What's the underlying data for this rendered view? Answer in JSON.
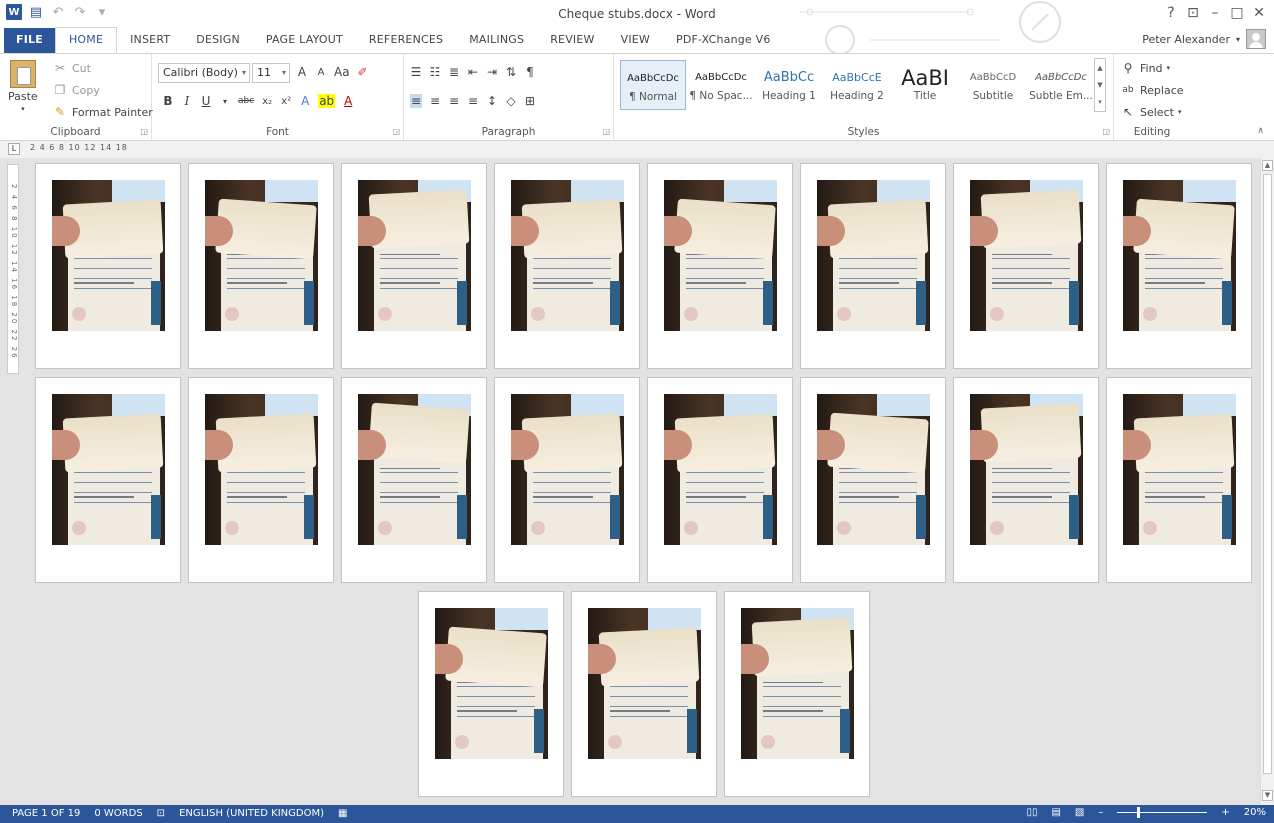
{
  "window": {
    "title": "Cheque stubs.docx - Word",
    "user_name": "Peter Alexander",
    "app_icon": "W"
  },
  "qat": {
    "save_icon": "save-icon",
    "undo_icon": "undo-icon",
    "redo_icon": "redo-icon",
    "customize_icon": "customize-qat-icon"
  },
  "window_controls": [
    "?",
    "⊡",
    "–",
    "□",
    "✕"
  ],
  "tabs": [
    {
      "label": "FILE"
    },
    {
      "label": "HOME"
    },
    {
      "label": "INSERT"
    },
    {
      "label": "DESIGN"
    },
    {
      "label": "PAGE LAYOUT"
    },
    {
      "label": "REFERENCES"
    },
    {
      "label": "MAILINGS"
    },
    {
      "label": "REVIEW"
    },
    {
      "label": "VIEW"
    },
    {
      "label": "PDF-XChange V6"
    }
  ],
  "ribbon": {
    "clipboard": {
      "label": "Clipboard",
      "paste": "Paste",
      "cut": "Cut",
      "copy": "Copy",
      "format_painter": "Format Painter"
    },
    "font": {
      "label": "Font",
      "font_name": "Calibri (Body)",
      "font_size": "11",
      "bold": "B",
      "italic": "I",
      "underline": "U",
      "strike": "abc",
      "subscript": "x₂",
      "superscript": "x²",
      "change_case": "Aa",
      "grow": "A",
      "shrink": "A"
    },
    "paragraph": {
      "label": "Paragraph"
    },
    "styles": {
      "label": "Styles",
      "items": [
        {
          "sample": "AaBbCcDc",
          "name": "¶ Normal"
        },
        {
          "sample": "AaBbCcDc",
          "name": "¶ No Spac..."
        },
        {
          "sample": "AaBbCc",
          "name": "Heading 1"
        },
        {
          "sample": "AaBbCcE",
          "name": "Heading 2"
        },
        {
          "sample": "AaBI",
          "name": "Title"
        },
        {
          "sample": "AaBbCcD",
          "name": "Subtitle"
        },
        {
          "sample": "AaBbCcDc",
          "name": "Subtle Em..."
        }
      ]
    },
    "editing": {
      "label": "Editing",
      "find": "Find",
      "replace": "Replace",
      "select": "Select"
    }
  },
  "ruler": {
    "tab_selector": "L",
    "marks": "2 4 6 8 10 12 14 18",
    "vertical_marks": "2 4 6 8 10 12 14 16 18 20 22 26"
  },
  "status": {
    "page": "PAGE 1 OF 19",
    "words": "0 WORDS",
    "language": "ENGLISH (UNITED KINGDOM)",
    "zoom": "20%"
  },
  "pages": {
    "count": 19
  }
}
